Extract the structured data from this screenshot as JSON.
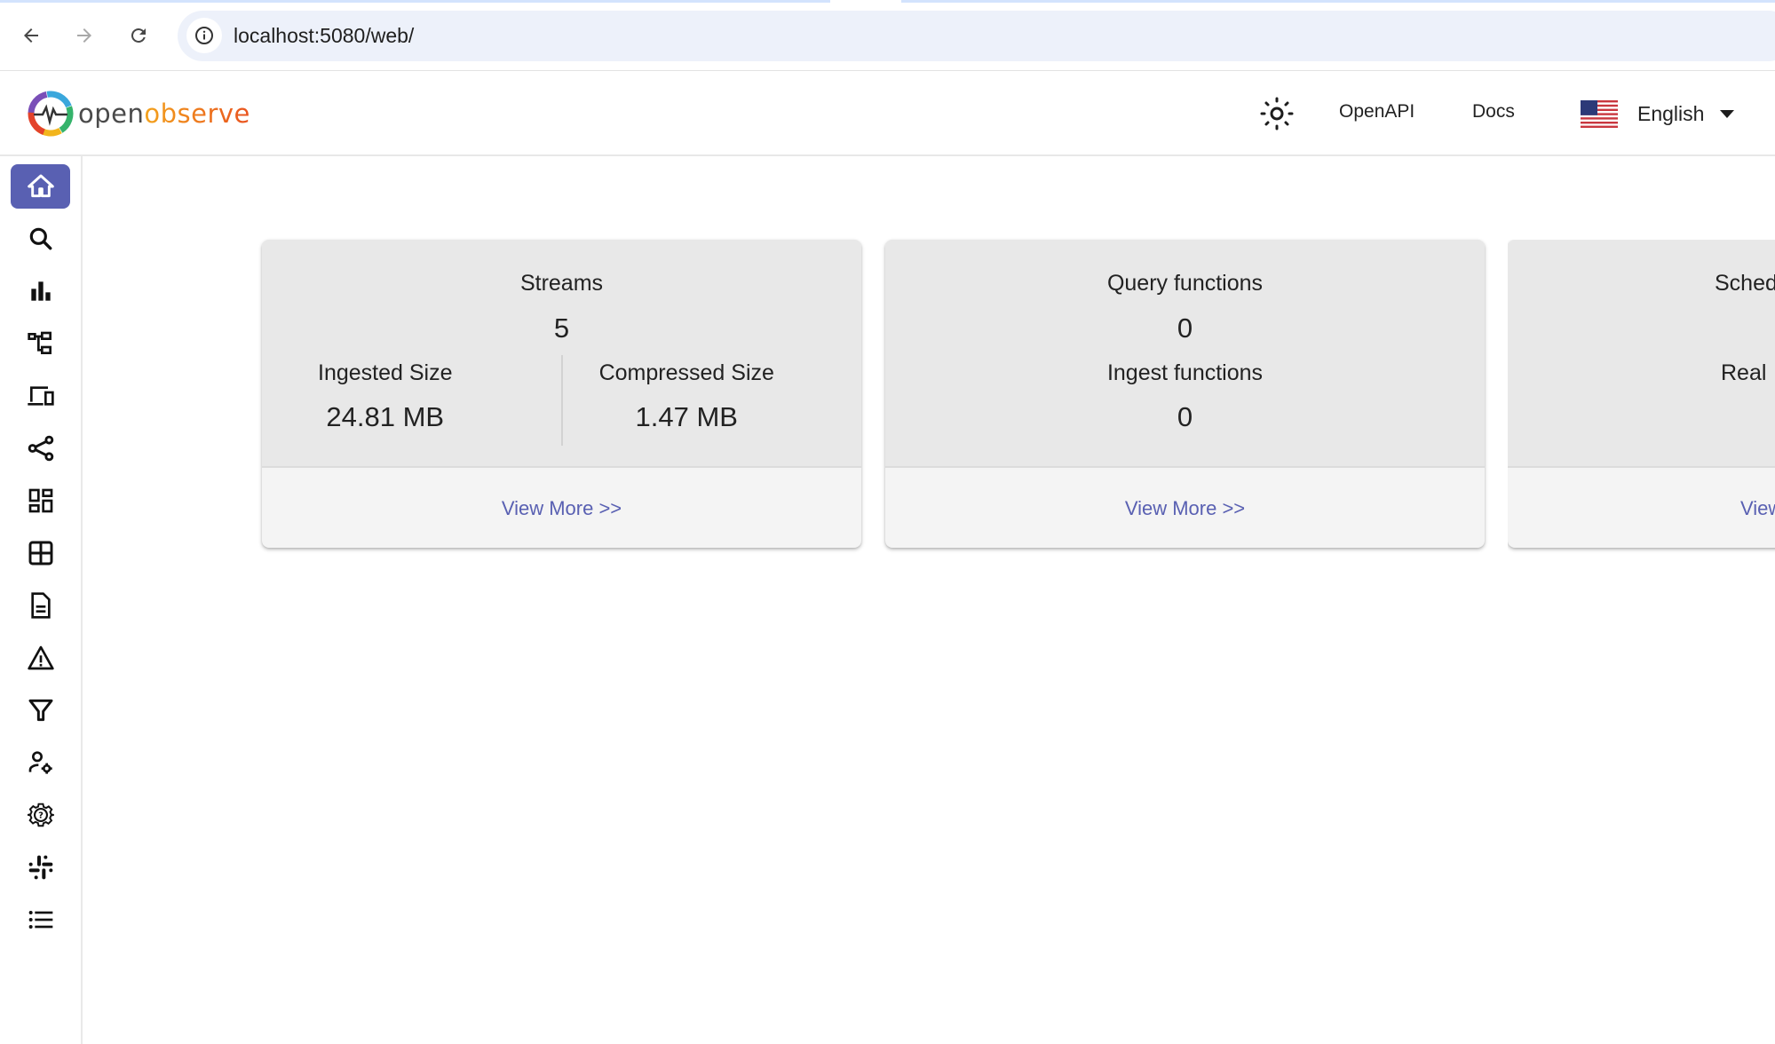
{
  "browser": {
    "url": "localhost:5080/web/",
    "back_icon": "arrow-left-icon",
    "forward_icon": "arrow-right-icon",
    "reload_icon": "reload-icon",
    "site_info_icon": "info-icon"
  },
  "header": {
    "logo_part1": "open",
    "logo_part2": "observe",
    "theme_icon": "sun-icon",
    "links": [
      "OpenAPI",
      "Docs"
    ],
    "language": "English",
    "flag_icon": "us-flag-icon"
  },
  "sidebar": {
    "items": [
      {
        "name": "home",
        "icon": "home-icon",
        "active": true
      },
      {
        "name": "logs",
        "icon": "search-icon"
      },
      {
        "name": "metrics",
        "icon": "bar-chart-icon"
      },
      {
        "name": "traces",
        "icon": "account-tree-icon"
      },
      {
        "name": "rum",
        "icon": "devices-icon"
      },
      {
        "name": "pipelines",
        "icon": "share-icon"
      },
      {
        "name": "dashboards",
        "icon": "dashboard-icon"
      },
      {
        "name": "streams",
        "icon": "grid-icon"
      },
      {
        "name": "reports",
        "icon": "document-icon"
      },
      {
        "name": "alerts",
        "icon": "warning-icon"
      },
      {
        "name": "functions",
        "icon": "filter-icon"
      },
      {
        "name": "iam",
        "icon": "user-settings-icon"
      },
      {
        "name": "settings",
        "icon": "help-gear-icon"
      },
      {
        "name": "slack",
        "icon": "slack-icon"
      },
      {
        "name": "about",
        "icon": "list-icon"
      }
    ],
    "accent_color": "#5960b2"
  },
  "cards": [
    {
      "title": "Streams",
      "value": "5",
      "left_label": "Ingested Size",
      "left_value": "24.81 MB",
      "right_label": "Compressed Size",
      "right_value": "1.47 MB",
      "link": "View More >>"
    },
    {
      "title": "Query functions",
      "value": "0",
      "sub_title": "Ingest functions",
      "sub_value": "0",
      "link": "View More >>"
    },
    {
      "title": "Sched",
      "sub_title": "Real",
      "link": "View"
    }
  ],
  "colors": {
    "link": "#5960b2",
    "card_top": "#e8e8e8",
    "card_bottom": "#f4f4f4"
  }
}
